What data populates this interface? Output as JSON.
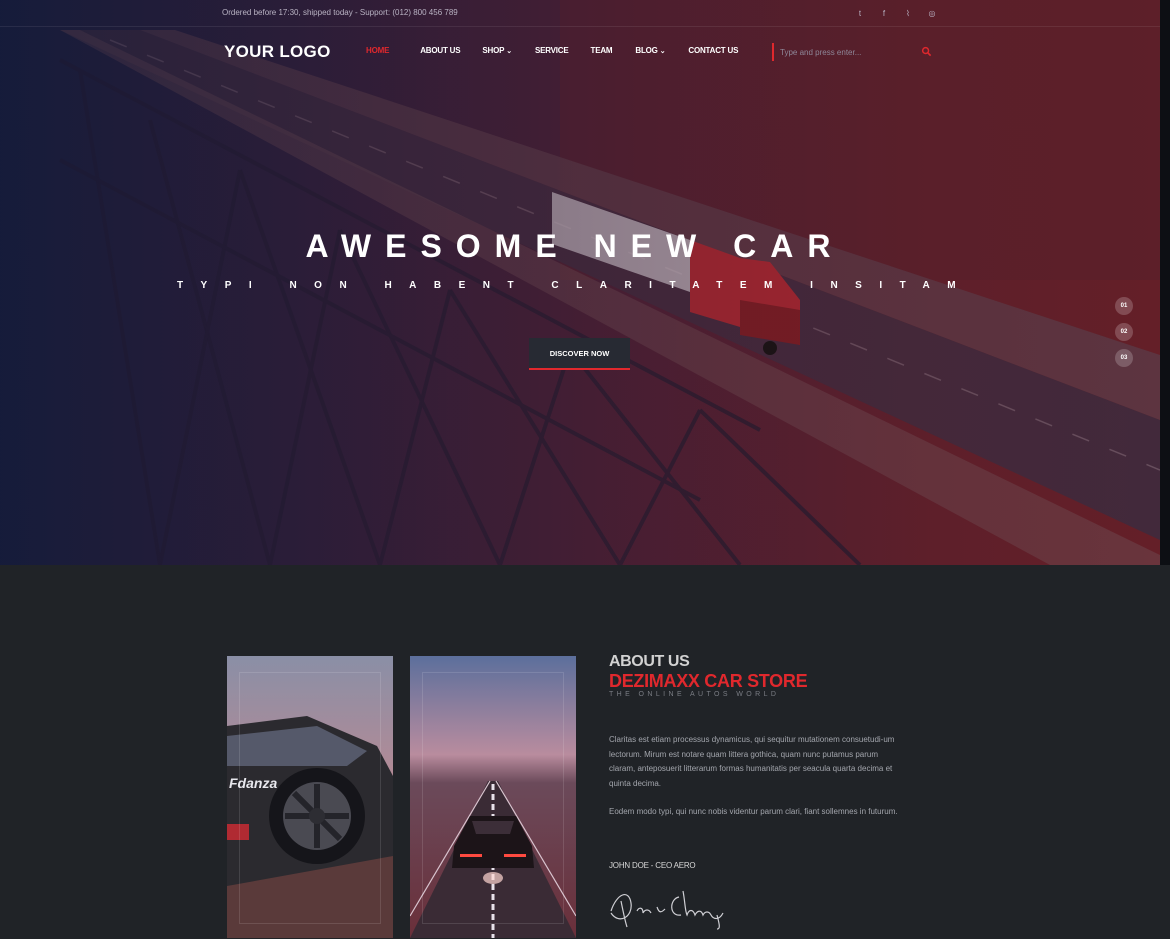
{
  "topbar": {
    "notice": "Ordered before 17:30, shipped today - Support: (012) 800 456 789",
    "social": [
      {
        "icon": "twitter-icon",
        "glyph": "t"
      },
      {
        "icon": "facebook-icon",
        "glyph": "f"
      },
      {
        "icon": "rss-icon",
        "glyph": "⌇"
      },
      {
        "icon": "dribbble-icon",
        "glyph": "◎"
      }
    ]
  },
  "nav": {
    "logo": "YOUR LOGO",
    "items": [
      {
        "label": "HOME",
        "active": true,
        "dropdown": false
      },
      {
        "label": "ABOUT US",
        "active": false,
        "dropdown": false
      },
      {
        "label": "SHOP",
        "active": false,
        "dropdown": true
      },
      {
        "label": "SERVICE",
        "active": false,
        "dropdown": false
      },
      {
        "label": "TEAM",
        "active": false,
        "dropdown": false
      },
      {
        "label": "BLOG",
        "active": false,
        "dropdown": true
      },
      {
        "label": "CONTACT US",
        "active": false,
        "dropdown": false
      }
    ],
    "search_placeholder": "Type and press enter..."
  },
  "hero": {
    "title": "AWESOME NEW CAR",
    "subtitle": "TYPI NON HABENT CLARITATEM INSITAM",
    "cta": "DISCOVER NOW",
    "slides": [
      "01",
      "02",
      "03"
    ]
  },
  "about": {
    "heading": "ABOUT US",
    "store_name": "DEZIMAXX CAR STORE",
    "tagline": "THE ONLINE AUTOS WORLD",
    "para1": "Claritas est etiam processus dynamicus, qui sequitur mutationem consuetudi-um lectorum. Mirum est notare quam littera gothica, quam nunc putamus parum claram, anteposuerit litterarum formas humanitatis per seacula quarta decima et quinta decima.",
    "para2": "Eodem modo typi, qui nunc nobis videntur parum clari, fiant sollemnes in futurum.",
    "signer": "JOHN DOE - CEO AERO",
    "photo1_text": "Fdanza"
  },
  "colors": {
    "accent": "#e0282d",
    "background": "#202327"
  }
}
